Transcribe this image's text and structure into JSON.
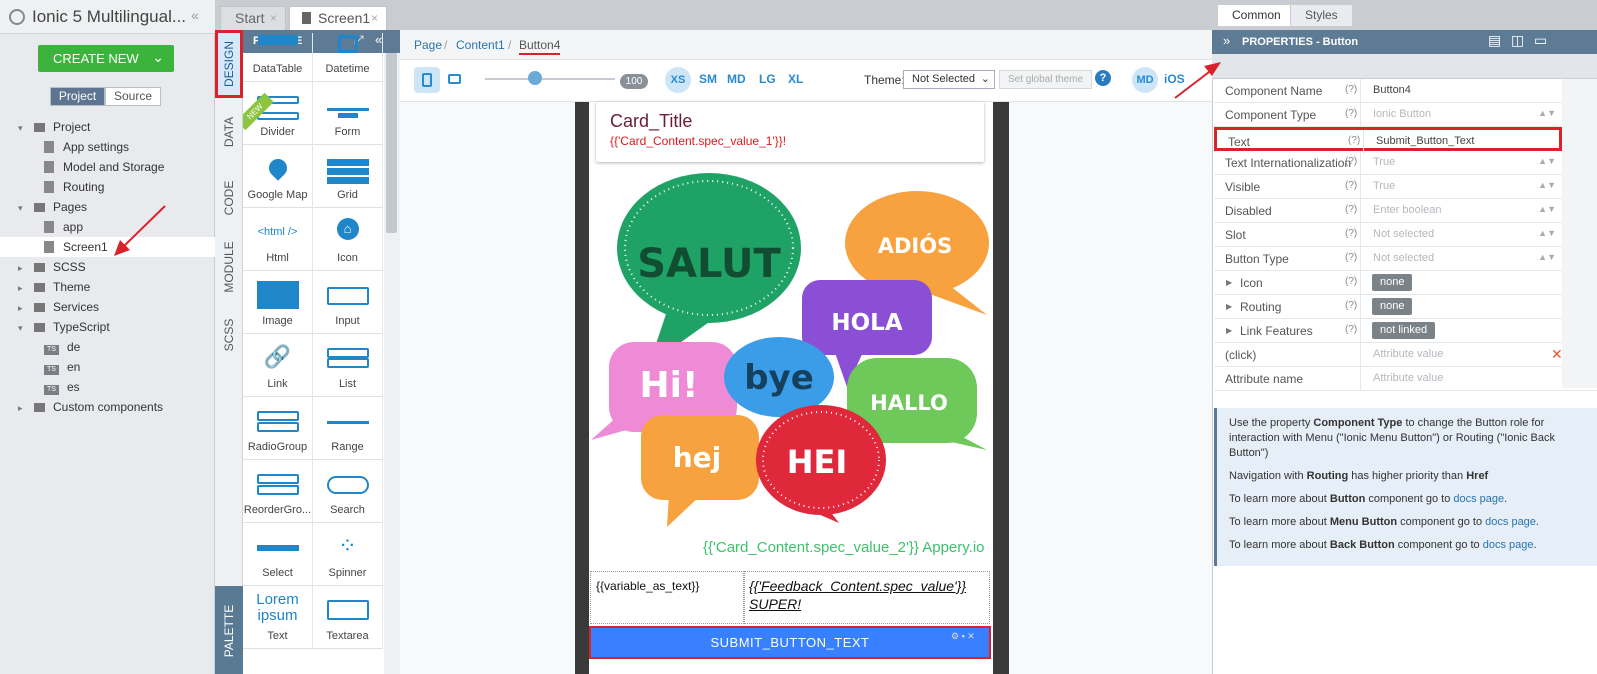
{
  "project": {
    "title": "Ionic 5 Multilingual...",
    "create_new": "CREATE NEW",
    "seg_project": "Project",
    "seg_source": "Source",
    "tree": [
      {
        "label": "Project",
        "kind": "folder",
        "level": 0
      },
      {
        "label": "App settings",
        "kind": "file",
        "level": 1
      },
      {
        "label": "Model and Storage",
        "kind": "file",
        "level": 1
      },
      {
        "label": "Routing",
        "kind": "file",
        "level": 1
      },
      {
        "label": "Pages",
        "kind": "folder",
        "level": 0
      },
      {
        "label": "app",
        "kind": "file",
        "level": 1
      },
      {
        "label": "Screen1",
        "kind": "file",
        "level": 1,
        "selected": true
      },
      {
        "label": "SCSS",
        "kind": "folder",
        "level": 0
      },
      {
        "label": "Theme",
        "kind": "folder",
        "level": 0
      },
      {
        "label": "Services",
        "kind": "folder",
        "level": 0
      },
      {
        "label": "TypeScript",
        "kind": "folder",
        "level": 0
      },
      {
        "label": "de",
        "kind": "ts",
        "level": 1
      },
      {
        "label": "en",
        "kind": "ts",
        "level": 1
      },
      {
        "label": "es",
        "kind": "ts",
        "level": 1
      },
      {
        "label": "Custom components",
        "kind": "folder",
        "level": 0
      }
    ]
  },
  "vtabs": {
    "design": "DESIGN",
    "data": "DATA",
    "code": "CODE",
    "module": "MODULE",
    "scss": "SCSS",
    "palette": "PALETTE"
  },
  "tabs": {
    "start": "Start",
    "screen1": "Screen1"
  },
  "palette": {
    "title": "PALETTE",
    "items": [
      {
        "label": "DataTable",
        "icon": "datatable-icon"
      },
      {
        "label": "Datetime",
        "icon": "calendar-icon"
      },
      {
        "label": "Divider",
        "icon": "divider-icon"
      },
      {
        "label": "Form",
        "icon": "form-icon"
      },
      {
        "label": "Google Map",
        "icon": "map-pin-icon"
      },
      {
        "label": "Grid",
        "icon": "grid-icon"
      },
      {
        "label": "Html",
        "icon": "html-icon",
        "glyph": "<html />"
      },
      {
        "label": "Icon",
        "icon": "home-icon"
      },
      {
        "label": "Image",
        "icon": "image-icon"
      },
      {
        "label": "Input",
        "icon": "input-icon"
      },
      {
        "label": "Link",
        "icon": "link-icon"
      },
      {
        "label": "List",
        "icon": "list-icon"
      },
      {
        "label": "RadioGroup",
        "icon": "radio-icon"
      },
      {
        "label": "Range",
        "icon": "range-icon"
      },
      {
        "label": "ReorderGro...",
        "icon": "reorder-icon"
      },
      {
        "label": "Search",
        "icon": "search-icon"
      },
      {
        "label": "Select",
        "icon": "select-icon"
      },
      {
        "label": "Spinner",
        "icon": "spinner-icon"
      },
      {
        "label": "Text",
        "icon": "text-icon",
        "glyph": "Lorem ipsum"
      },
      {
        "label": "Textarea",
        "icon": "textarea-icon"
      }
    ],
    "new_badge": "NEW"
  },
  "breadcrumb": {
    "page": "Page",
    "content1": "Content1",
    "button4": "Button4"
  },
  "toolbar": {
    "zoom": "100",
    "xs": "XS",
    "sm": "SM",
    "md": "MD",
    "lg": "LG",
    "xl": "XL",
    "theme_label": "Theme:",
    "theme_value": "Not Selected",
    "set_global": "Set global theme",
    "mode_md": "MD",
    "mode_ios": "iOS"
  },
  "screen": {
    "card_title": "Card_Title",
    "card_sub": "{{'Card_Content.spec_value_1'}}!",
    "bubbles": [
      "SALUT",
      "ADIÓS",
      "HOLA",
      "Hi!",
      "bye",
      "HALLO",
      "hej",
      "HEI"
    ],
    "spec2": "{{'Card_Content.spec_value_2'}} Appery.io",
    "var_text": "{{variable_as_text}}",
    "feedback": "{{'Feedback_Content.spec_value'}} SUPER!",
    "submit": "SUBMIT_BUTTON_TEXT"
  },
  "properties": {
    "title": "PROPERTIES - Button",
    "tab_common": "Common",
    "tab_styles": "Styles",
    "rows": [
      {
        "name": "Component Name",
        "q": "(?)",
        "value": "Button4"
      },
      {
        "name": "Component Type",
        "q": "(?)",
        "value": "Ionic Button"
      },
      {
        "name": "Text",
        "q": "(?)",
        "value": "Submit_Button_Text"
      },
      {
        "name": "Text Internationalization",
        "q": "(?)",
        "value": "True"
      },
      {
        "name": "Visible",
        "q": "(?)",
        "value": "True"
      },
      {
        "name": "Disabled",
        "q": "(?)",
        "value": "Enter boolean"
      },
      {
        "name": "Slot",
        "q": "(?)",
        "value": "Not selected"
      },
      {
        "name": "Button Type",
        "q": "(?)",
        "value": "Not selected"
      },
      {
        "name": "Icon",
        "q": "(?)",
        "value": "none"
      },
      {
        "name": "Routing",
        "q": "(?)",
        "value": "none"
      },
      {
        "name": "Link Features",
        "q": "(?)",
        "value": "not linked"
      },
      {
        "name": "(click)",
        "q": "",
        "value": "Attribute value"
      },
      {
        "name": "Attribute name",
        "q": "",
        "value": "Attribute value"
      }
    ],
    "help": {
      "p1a": "Use the property ",
      "p1b": "Component Type",
      "p1c": " to change the Button role for interaction with Menu (\"Ionic Menu Button\") or Routing (\"Ionic Back Button\")",
      "p2a": "Navigation with ",
      "p2b": "Routing",
      "p2c": " has higher priority than ",
      "p2d": "Href",
      "p3a": "To learn more about ",
      "p3b": "Button",
      "p3c": " component go to ",
      "p4b": "Menu Button",
      "p5b": "Back Button",
      "link": "docs page",
      "dot": "."
    }
  },
  "colors": {
    "accent": "#3880ff",
    "header": "#5e7b95",
    "highlight": "#d9222a",
    "create": "#3cb33c"
  }
}
